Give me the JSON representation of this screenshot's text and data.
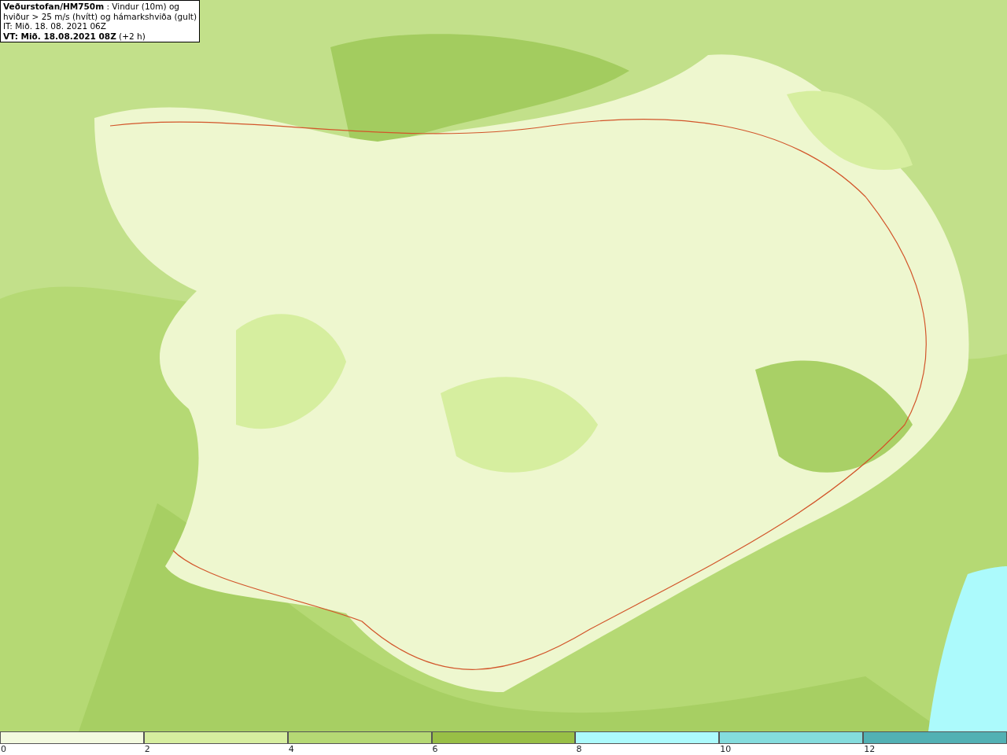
{
  "info_box": {
    "lines": [
      "**Veðurstofan/HM750m** : Vindur (10m) og",
      "hviður > 25 m/s (hvítt) og hámarkshviða (gult)",
      "IT: Mið. 18. 08. 2021 06Z",
      "**VT: Mið. 18.08.2021 08Z** (+2 h)"
    ]
  },
  "legend": {
    "bins": [
      {
        "label": "0",
        "color": "#f3fadf"
      },
      {
        "label": "2",
        "color": "#d6ee9f"
      },
      {
        "label": "4",
        "color": "#b5d974"
      },
      {
        "label": "6",
        "color": "#98bf46"
      },
      {
        "label": "8",
        "color": "#acfafc"
      },
      {
        "label": "10",
        "color": "#84dcdd"
      },
      {
        "label": "12",
        "color": "#52b1b4"
      }
    ]
  }
}
